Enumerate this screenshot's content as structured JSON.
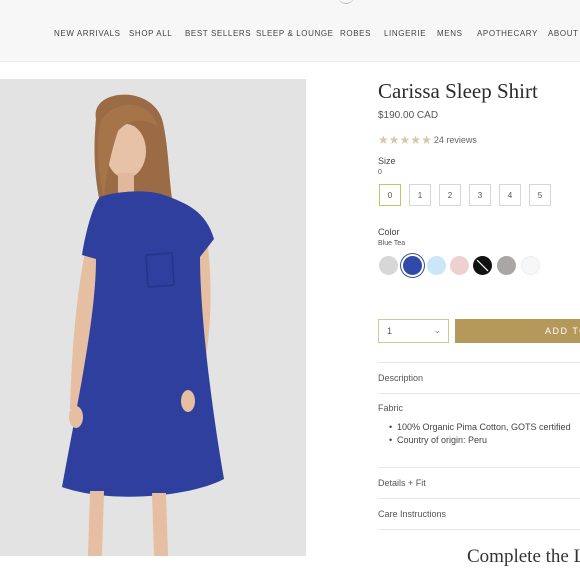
{
  "nav": {
    "items": [
      "NEW ARRIVALS",
      "SHOP ALL",
      "BEST SELLERS",
      "SLEEP & LOUNGE",
      "ROBES",
      "LINGERIE",
      "MENS",
      "APOTHECARY",
      "ABOUT"
    ]
  },
  "product": {
    "title": "Carissa Sleep Shirt",
    "price": "$190.00 CAD",
    "rating": 5,
    "reviews": "24 reviews"
  },
  "size": {
    "label": "Size",
    "selected": "0",
    "options": [
      "0",
      "1",
      "2",
      "3",
      "4",
      "5"
    ]
  },
  "color": {
    "label": "Color",
    "selected": "Blue Tea",
    "swatches": [
      {
        "name": "light-grey",
        "hex": "#d7d7d7"
      },
      {
        "name": "blue-tea",
        "hex": "#2f4aa8"
      },
      {
        "name": "light-blue",
        "hex": "#cbe6f7"
      },
      {
        "name": "blush",
        "hex": "#efd0d0"
      },
      {
        "name": "black",
        "hex": "#111111"
      },
      {
        "name": "grey",
        "hex": "#a9a6a3"
      },
      {
        "name": "white",
        "hex": "#f7f7f7"
      }
    ]
  },
  "purchase": {
    "quantity": "1",
    "add_label": "ADD TO"
  },
  "details": {
    "description_label": "Description",
    "fabric_label": "Fabric",
    "fabric_bullets": [
      "100% Organic Pima Cotton, GOTS certified",
      "Country of origin: Peru"
    ],
    "details_fit_label": "Details + Fit",
    "care_label": "Care Instructions"
  },
  "complete_heading": "Complete the L",
  "colors": {
    "accent": "#b5995a",
    "selected_border": "#c2c36a",
    "dress": "#2f3f9e"
  }
}
